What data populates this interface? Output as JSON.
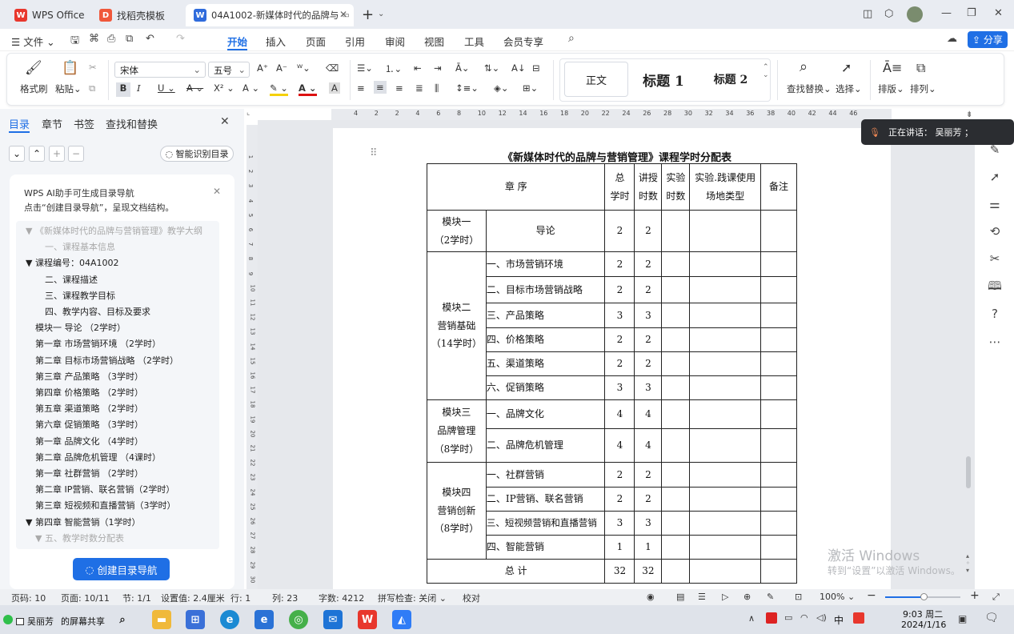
{
  "titlebar": {
    "tabs": [
      {
        "label": "WPS Office",
        "icon": "wps-logo-icon"
      },
      {
        "label": "找稻壳模板",
        "icon": "docer-icon"
      },
      {
        "label": "04A1002-新媒体时代的品牌与",
        "icon": "word-doc-icon"
      }
    ],
    "new_tab": "+"
  },
  "menubar": {
    "file": "文件",
    "items": [
      "开始",
      "插入",
      "页面",
      "引用",
      "审阅",
      "视图",
      "工具",
      "会员专享"
    ],
    "share": "分享"
  },
  "ribbon": {
    "format_brush": "格式刷",
    "paste": "粘贴",
    "font_name": "宋体",
    "font_size": "五号",
    "styles": [
      "正文",
      "标题 1",
      "标题 2"
    ],
    "find_replace": "查找替换",
    "select": "选择",
    "layout": "排版",
    "arrange": "排列"
  },
  "leftpanel": {
    "tabs": [
      "目录",
      "章节",
      "书签",
      "查找和替换"
    ],
    "smart_toc": "智能识别目录",
    "ai_tip_line1": "WPS AI助手可生成目录导航",
    "ai_tip_line2": "点击“创建目录导航”，呈现文档结构。",
    "toc": [
      {
        "text": "▼ 《新媒体时代的品牌与营销管理》教学大纲",
        "dim": true,
        "indent": 0
      },
      {
        "text": "一、课程基本信息",
        "dim": true,
        "indent": 2
      },
      {
        "text": "▼ 课程编号：04A1002",
        "dim": false,
        "indent": 0
      },
      {
        "text": "二、课程描述",
        "dim": false,
        "indent": 2
      },
      {
        "text": "三、课程教学目标",
        "dim": false,
        "indent": 2
      },
      {
        "text": "四、教学内容、目标及要求",
        "dim": false,
        "indent": 2
      },
      {
        "text": "模块一 导论 （2学时）",
        "dim": false,
        "indent": 1
      },
      {
        "text": "第一章 市场营销环境 （2学时）",
        "dim": false,
        "indent": 1
      },
      {
        "text": "第二章 目标市场营销战略 （2学时）",
        "dim": false,
        "indent": 1
      },
      {
        "text": "第三章 产品策略 （3学时）",
        "dim": false,
        "indent": 1
      },
      {
        "text": "第四章 价格策略 （2学时）",
        "dim": false,
        "indent": 1
      },
      {
        "text": "第五章 渠道策略 （2学时）",
        "dim": false,
        "indent": 1
      },
      {
        "text": "第六章 促销策略 （3学时）",
        "dim": false,
        "indent": 1
      },
      {
        "text": "第一章 品牌文化 （4学时）",
        "dim": false,
        "indent": 1
      },
      {
        "text": "第二章 品牌危机管理 （4课时）",
        "dim": false,
        "indent": 1
      },
      {
        "text": "第一章 社群营销 （2学时）",
        "dim": false,
        "indent": 1
      },
      {
        "text": "第二章 IP营销、联名营销（2学时）",
        "dim": false,
        "indent": 1
      },
      {
        "text": "第三章 短视频和直播营销（3学时）",
        "dim": false,
        "indent": 1
      },
      {
        "text": "▼ 第四章 智能营销（1学时）",
        "dim": false,
        "indent": 0
      },
      {
        "text": "▼ 五、教学时数分配表",
        "dim": true,
        "indent": 1
      }
    ],
    "create_btn": "创建目录导航"
  },
  "ruler": {
    "h_ticks": [
      "4",
      "2",
      "2",
      "4",
      "6",
      "8",
      "10",
      "12",
      "14",
      "16",
      "18",
      "20",
      "22",
      "24",
      "26",
      "28",
      "30",
      "32",
      "34",
      "36",
      "38",
      "40",
      "42",
      "44",
      "46"
    ],
    "v_ticks": [
      "1",
      "2",
      "3",
      "4",
      "5",
      "6",
      "7",
      "8",
      "9",
      "10",
      "11",
      "12",
      "13",
      "14",
      "15",
      "16",
      "17",
      "18",
      "19",
      "20",
      "21",
      "22",
      "23",
      "24",
      "25",
      "26",
      "27",
      "28",
      "29",
      "30"
    ]
  },
  "document": {
    "title": "《新媒体时代的品牌与营销管理》课程学时分配表",
    "header": {
      "chapter": "章 序",
      "total_1": "总",
      "total_2": "学时",
      "lecture_1": "讲授",
      "lecture_2": "时数",
      "lab_1": "实验",
      "lab_2": "时数",
      "site_1": "实验.践课使用",
      "site_2": "场地类型",
      "remark": "备注"
    },
    "module1": {
      "name": "模块一",
      "hours": "（2学时）",
      "rows": [
        {
          "chapter": "导论",
          "total": "2",
          "lecture": "2"
        }
      ]
    },
    "module2": {
      "name": "模块二",
      "sub": "营销基础",
      "hours": "（14学时）",
      "rows": [
        {
          "chapter": "一、市场营销环境",
          "total": "2",
          "lecture": "2"
        },
        {
          "chapter": "二、目标市场营销战略",
          "total": "2",
          "lecture": "2"
        },
        {
          "chapter": "三、产品策略",
          "total": "3",
          "lecture": "3"
        },
        {
          "chapter": "四、价格策略",
          "total": "2",
          "lecture": "2"
        },
        {
          "chapter": "五、渠道策略",
          "total": "2",
          "lecture": "2"
        },
        {
          "chapter": "六、促销策略",
          "total": "3",
          "lecture": "3"
        }
      ]
    },
    "module3": {
      "name": "模块三",
      "sub": "品牌管理",
      "hours": "（8学时）",
      "rows": [
        {
          "chapter": "一、品牌文化",
          "total": "4",
          "lecture": "4"
        },
        {
          "chapter": "二、品牌危机管理",
          "total": "4",
          "lecture": "4"
        }
      ]
    },
    "module4": {
      "name": "模块四",
      "sub": "营销创新",
      "hours": "（8学时）",
      "rows": [
        {
          "chapter": "一、社群营销",
          "total": "2",
          "lecture": "2"
        },
        {
          "chapter": "二、IP营销、联名营销",
          "total": "2",
          "lecture": "2"
        },
        {
          "chapter": "三、短视频营销和直播营销",
          "total": "3",
          "lecture": "3"
        },
        {
          "chapter": "四、智能营销",
          "total": "1",
          "lecture": "1"
        }
      ]
    },
    "total": {
      "label": "总 计",
      "total": "32",
      "lecture": "32"
    }
  },
  "notice": {
    "text": "正在讲话： 吴丽芳 ；"
  },
  "watermark": {
    "line1": "激活 Windows",
    "line2": "转到“设置”以激活 Windows。"
  },
  "statusbar": {
    "page_no": "页码: 10",
    "pages": "页面: 10/11",
    "section": "节: 1/1",
    "setting": "设置值: 2.4厘米",
    "row": "行: 1",
    "col": "列: 23",
    "words": "字数: 4212",
    "spell": "拼写检查: 关闭",
    "proof": "校对",
    "zoom": "100%"
  },
  "taskbar": {
    "share_label": "吴丽芳",
    "share_suffix": "的屏幕共享",
    "ime": "中",
    "time": "9:03 周二",
    "date": "2024/1/16"
  },
  "colors": {
    "accent": "#1f6fe5",
    "wps_red": "#e8372d"
  }
}
